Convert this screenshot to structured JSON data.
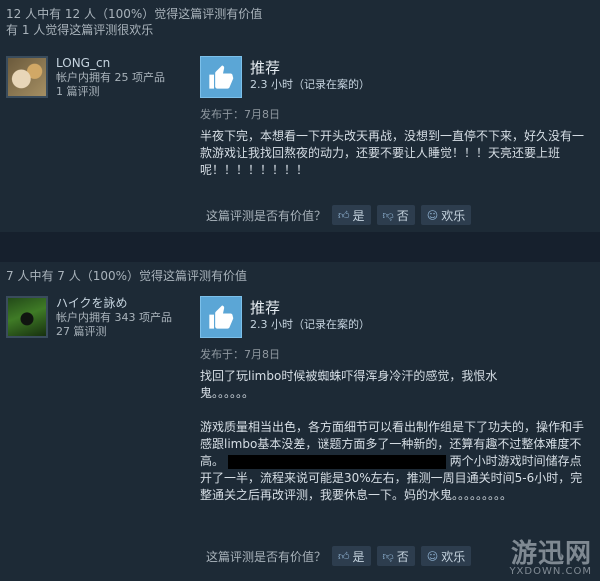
{
  "reviews": [
    {
      "helpful": "12 人中有 12 人（100%）觉得这篇评测有价值",
      "funny": "有 1 人觉得这篇评测很欢乐",
      "author": {
        "name": "LONG_cn",
        "products": "帐户内拥有 25 项产品",
        "reviews": "1 篇评测"
      },
      "recommendation": "推荐",
      "hours": "2.3 小时（记录在案的）",
      "posted": "发布于：7月8日",
      "content": [
        "半夜下完，本想看一下开头改天再战，没想到一直停不下来，好久没有一款游戏让我找回熬夜的动力，还要不要让人睡觉！！！天亮还要上班呢！！！！！！！！"
      ],
      "vote": {
        "question": "这篇评测是否有价值？",
        "yes": "是",
        "no": "否",
        "funny": "欢乐"
      }
    },
    {
      "helpful": "7 人中有 7 人（100%）觉得这篇评测有价值",
      "author": {
        "name": "ハイクを詠め",
        "products": "帐户内拥有 343 项产品",
        "reviews": "27 篇评测"
      },
      "recommendation": "推荐",
      "hours": "2.3 小时（记录在案的）",
      "posted": "发布于：7月8日",
      "content": [
        "找回了玩limbo时候被蜘蛛吓得浑身冷汗的感觉，我恨水鬼。。。。。。",
        "游戏质量相当出色，各方面细节可以看出制作组是下了功夫的，操作和手感跟limbo基本没差，谜题方面多了一种新的，还算有趣不过整体难度不高。",
        "两个小时游戏时间储存点开了一半，流程来说可能是30%左右，推测一周目通关时间5-6小时，完整通关之后再改评测，我要休息一下。妈的水鬼。。。。。。。。。"
      ],
      "vote": {
        "question": "这篇评测是否有价值？",
        "yes": "是",
        "no": "否",
        "funny": "欢乐"
      }
    }
  ],
  "watermark": {
    "main": "游迅网",
    "sub": "YXDOWN.COM"
  },
  "colors": {
    "background": "#1b2838",
    "thumb": "#5ba6d6",
    "button": "#2d3d4e"
  }
}
